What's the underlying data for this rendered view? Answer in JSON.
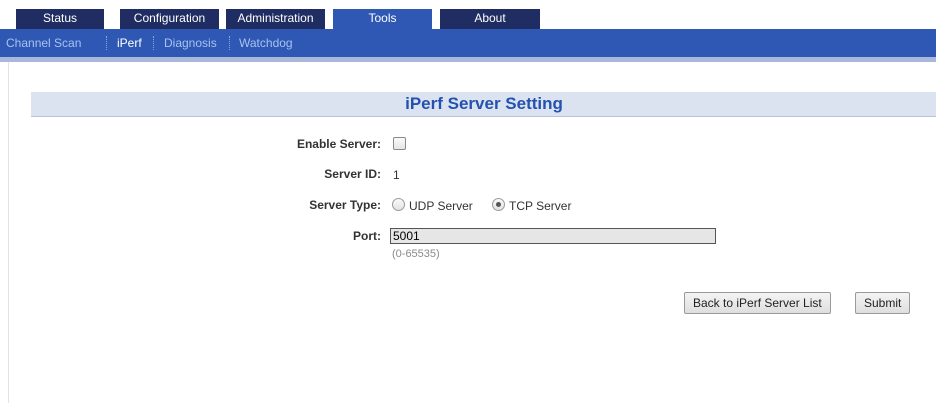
{
  "nav": {
    "tabs": [
      {
        "label": "Status",
        "active": false
      },
      {
        "label": "Configuration",
        "active": false
      },
      {
        "label": "Administration",
        "active": false
      },
      {
        "label": "Tools",
        "active": true
      },
      {
        "label": "About",
        "active": false
      }
    ],
    "subnav": [
      {
        "label": "Channel Scan",
        "active": false
      },
      {
        "label": "iPerf",
        "active": true
      },
      {
        "label": "Diagnosis",
        "active": false
      },
      {
        "label": "Watchdog",
        "active": false
      }
    ]
  },
  "form": {
    "title": "iPerf Server Setting",
    "enable_label": "Enable Server:",
    "enable_checked": false,
    "server_id_label": "Server ID:",
    "server_id_value": "1",
    "server_type_label": "Server Type:",
    "udp_label": "UDP Server",
    "tcp_label": "TCP Server",
    "server_type_selected": "TCP Server",
    "port_label": "Port:",
    "port_value": "5001",
    "port_hint": "(0-65535)"
  },
  "actions": {
    "back_label": "Back to iPerf Server List",
    "submit_label": "Submit"
  },
  "colors": {
    "tab_dark": "#1f2d63",
    "nav_blue": "#2e58b3",
    "title_blue": "#2451b0",
    "title_bg": "#dbe3f1"
  }
}
